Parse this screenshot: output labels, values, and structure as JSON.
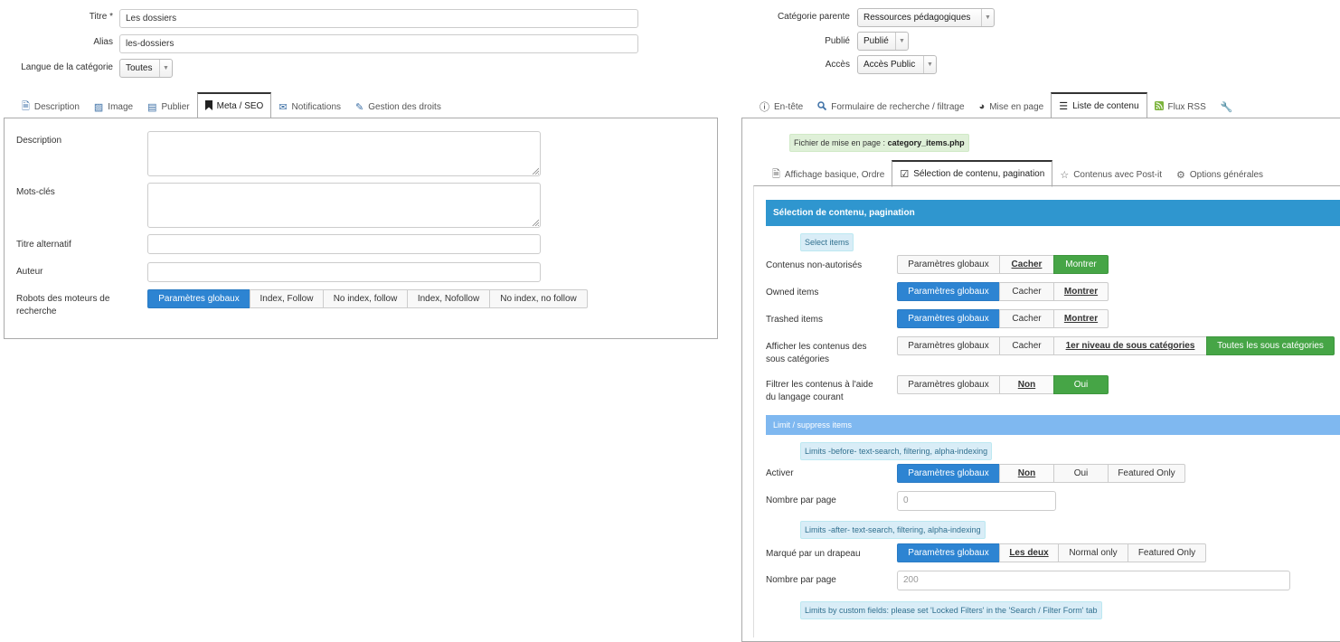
{
  "left": {
    "title_label": "Titre *",
    "title_value": "Les dossiers",
    "alias_label": "Alias",
    "alias_value": "les-dossiers",
    "lang_label": "Langue de la catégorie",
    "lang_value": "Toutes",
    "tabs": [
      {
        "label": "Description",
        "icon": "file-icon"
      },
      {
        "label": "Image",
        "icon": "image-icon"
      },
      {
        "label": "Publier",
        "icon": "calendar-icon"
      },
      {
        "label": "Meta / SEO",
        "icon": "bookmark-icon"
      },
      {
        "label": "Notifications",
        "icon": "envelope-icon"
      },
      {
        "label": "Gestion des droits",
        "icon": "wrench-icon"
      }
    ],
    "meta": {
      "description_label": "Description",
      "keywords_label": "Mots-clés",
      "alt_title_label": "Titre alternatif",
      "author_label": "Auteur",
      "robots_label_1": "Robots des moteurs de",
      "robots_label_2": "recherche",
      "robots_options": [
        "Paramètres globaux",
        "Index, Follow",
        "No index, follow",
        "Index, Nofollow",
        "No index, no follow"
      ]
    }
  },
  "right": {
    "parent_label": "Catégorie parente",
    "parent_value": "Ressources pédagogiques",
    "published_label": "Publié",
    "published_value": "Publié",
    "access_label": "Accès",
    "access_value": "Accès Public",
    "tabs": [
      {
        "label": "En-tête",
        "icon": "info-icon"
      },
      {
        "label": "Formulaire de recherche / filtrage",
        "icon": "search-icon"
      },
      {
        "label": "Mise en page",
        "icon": "palette-icon"
      },
      {
        "label": "Liste de contenu",
        "icon": "list-icon"
      },
      {
        "label": "Flux RSS",
        "icon": "rss-icon"
      },
      {
        "label": "",
        "icon": "wrench-icon"
      }
    ],
    "layout_file_prefix": "Fichier de mise en page :",
    "layout_file": "category_items.php",
    "subtabs": [
      {
        "label": "Affichage basique, Ordre",
        "icon": "file-icon"
      },
      {
        "label": "Sélection de contenu, pagination",
        "icon": "checkbox-icon"
      },
      {
        "label": "Contenus avec Post-it",
        "icon": "star-icon"
      },
      {
        "label": "Options générales",
        "icon": "gear-icon"
      }
    ],
    "section_title": "Sélection de contenu, pagination",
    "select_items_note": "Select items",
    "rows": {
      "unauthorized": {
        "label": "Contenus non-autorisés",
        "options": [
          "Paramètres globaux",
          "Cacher",
          "Montrer"
        ]
      },
      "owned": {
        "label": "Owned items",
        "options": [
          "Paramètres globaux",
          "Cacher",
          "Montrer"
        ]
      },
      "trashed": {
        "label": "Trashed items",
        "options": [
          "Paramètres globaux",
          "Cacher",
          "Montrer"
        ]
      },
      "subcats": {
        "label_1": "Afficher les contenus des",
        "label_2": "sous catégories",
        "options": [
          "Paramètres globaux",
          "Cacher",
          "1er niveau de sous catégories",
          "Toutes les sous catégories"
        ]
      },
      "lang_filter": {
        "label_1": "Filtrer les contenus à l'aide",
        "label_2": "du langage courant",
        "options": [
          "Paramètres globaux",
          "Non",
          "Oui"
        ]
      }
    },
    "limit_bar": "Limit / suppress items",
    "before_note": "Limits -before- text-search, filtering, alpha-indexing",
    "activate": {
      "label": "Activer",
      "options": [
        "Paramètres globaux",
        "Non",
        "Oui",
        "Featured Only"
      ]
    },
    "per_page_1": {
      "label": "Nombre par page",
      "value": "0"
    },
    "after_note": "Limits -after- text-search, filtering, alpha-indexing",
    "flagged": {
      "label": "Marqué par un drapeau",
      "options": [
        "Paramètres globaux",
        "Les deux",
        "Normal only",
        "Featured Only"
      ]
    },
    "per_page_2": {
      "label": "Nombre par page",
      "value": "200"
    },
    "custom_note": "Limits by custom fields: please set 'Locked Filters' in the 'Search / Filter Form' tab"
  },
  "colors": {
    "blue": "#2d84d2",
    "green": "#46a546",
    "section_bar": "#2f96cf",
    "limit_bar": "#7fb8f0"
  }
}
